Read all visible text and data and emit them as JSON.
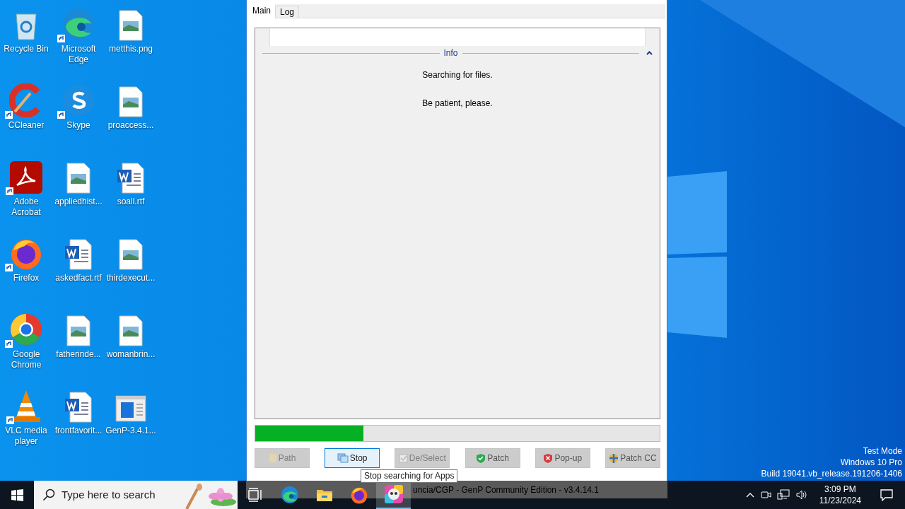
{
  "desktop_icons": [
    {
      "label": "Recycle Bin",
      "kind": "recycle",
      "shortcut": false
    },
    {
      "label": "Microsoft Edge",
      "kind": "edge",
      "shortcut": true
    },
    {
      "label": "metthis.png",
      "kind": "image",
      "shortcut": false
    },
    {
      "label": "CCleaner",
      "kind": "ccleaner",
      "shortcut": true
    },
    {
      "label": "Skype",
      "kind": "skype",
      "shortcut": true
    },
    {
      "label": "proaccess...",
      "kind": "image",
      "shortcut": false
    },
    {
      "label": "Adobe Acrobat",
      "kind": "acrobat",
      "shortcut": true
    },
    {
      "label": "appliedhist...",
      "kind": "image",
      "shortcut": false
    },
    {
      "label": "soall.rtf",
      "kind": "word",
      "shortcut": false
    },
    {
      "label": "Firefox",
      "kind": "firefox",
      "shortcut": true
    },
    {
      "label": "askedfact.rtf",
      "kind": "word",
      "shortcut": false
    },
    {
      "label": "thirdexecut...",
      "kind": "image",
      "shortcut": false
    },
    {
      "label": "Google Chrome",
      "kind": "chrome",
      "shortcut": true
    },
    {
      "label": "fatherinde...",
      "kind": "image",
      "shortcut": false
    },
    {
      "label": "womanbrin...",
      "kind": "image",
      "shortcut": false
    },
    {
      "label": "VLC media player",
      "kind": "vlc",
      "shortcut": true
    },
    {
      "label": "frontfavorit...",
      "kind": "word",
      "shortcut": false
    },
    {
      "label": "GenP-3.4.1...",
      "kind": "app",
      "shortcut": false
    }
  ],
  "app": {
    "tabs": [
      {
        "label": "Main",
        "selected": true
      },
      {
        "label": "Log",
        "selected": false
      }
    ],
    "info": {
      "title": "Info",
      "expanded": true,
      "lines": [
        "Searching for files.",
        "Be patient, please."
      ]
    },
    "progress": {
      "level": 0.267
    },
    "buttons": [
      {
        "label": "Path",
        "kind": "folder",
        "disabled": true,
        "hovered": false
      },
      {
        "label": "Stop",
        "kind": "stop",
        "disabled": false,
        "hovered": true
      },
      {
        "label": "De/Select",
        "kind": "check",
        "disabled": true,
        "hovered": false
      },
      {
        "label": "Patch",
        "kind": "shield-ok",
        "disabled": false,
        "hovered": false
      },
      {
        "label": "Pop-up",
        "kind": "shield-x",
        "disabled": false,
        "hovered": false
      },
      {
        "label": "Patch CC",
        "kind": "shield-win",
        "disabled": false,
        "hovered": false
      }
    ],
    "tooltip": "Stop searching for Apps",
    "footer": "uncia/CGP - GenP Community Edition - v3.4.14.1"
  },
  "system_info": [
    "Test Mode",
    "Windows 10 Pro",
    "Build 19041.vb_release.191206-1406"
  ],
  "taskbar": {
    "search_placeholder": "Type here to search",
    "apps": [
      {
        "kind": "taskview",
        "selected": false
      },
      {
        "kind": "edge",
        "selected": false
      },
      {
        "kind": "explorer",
        "selected": false
      },
      {
        "kind": "firefox",
        "selected": false
      },
      {
        "kind": "genp",
        "selected": true
      }
    ],
    "time": "3:09 PM",
    "date": "11/23/2024"
  }
}
